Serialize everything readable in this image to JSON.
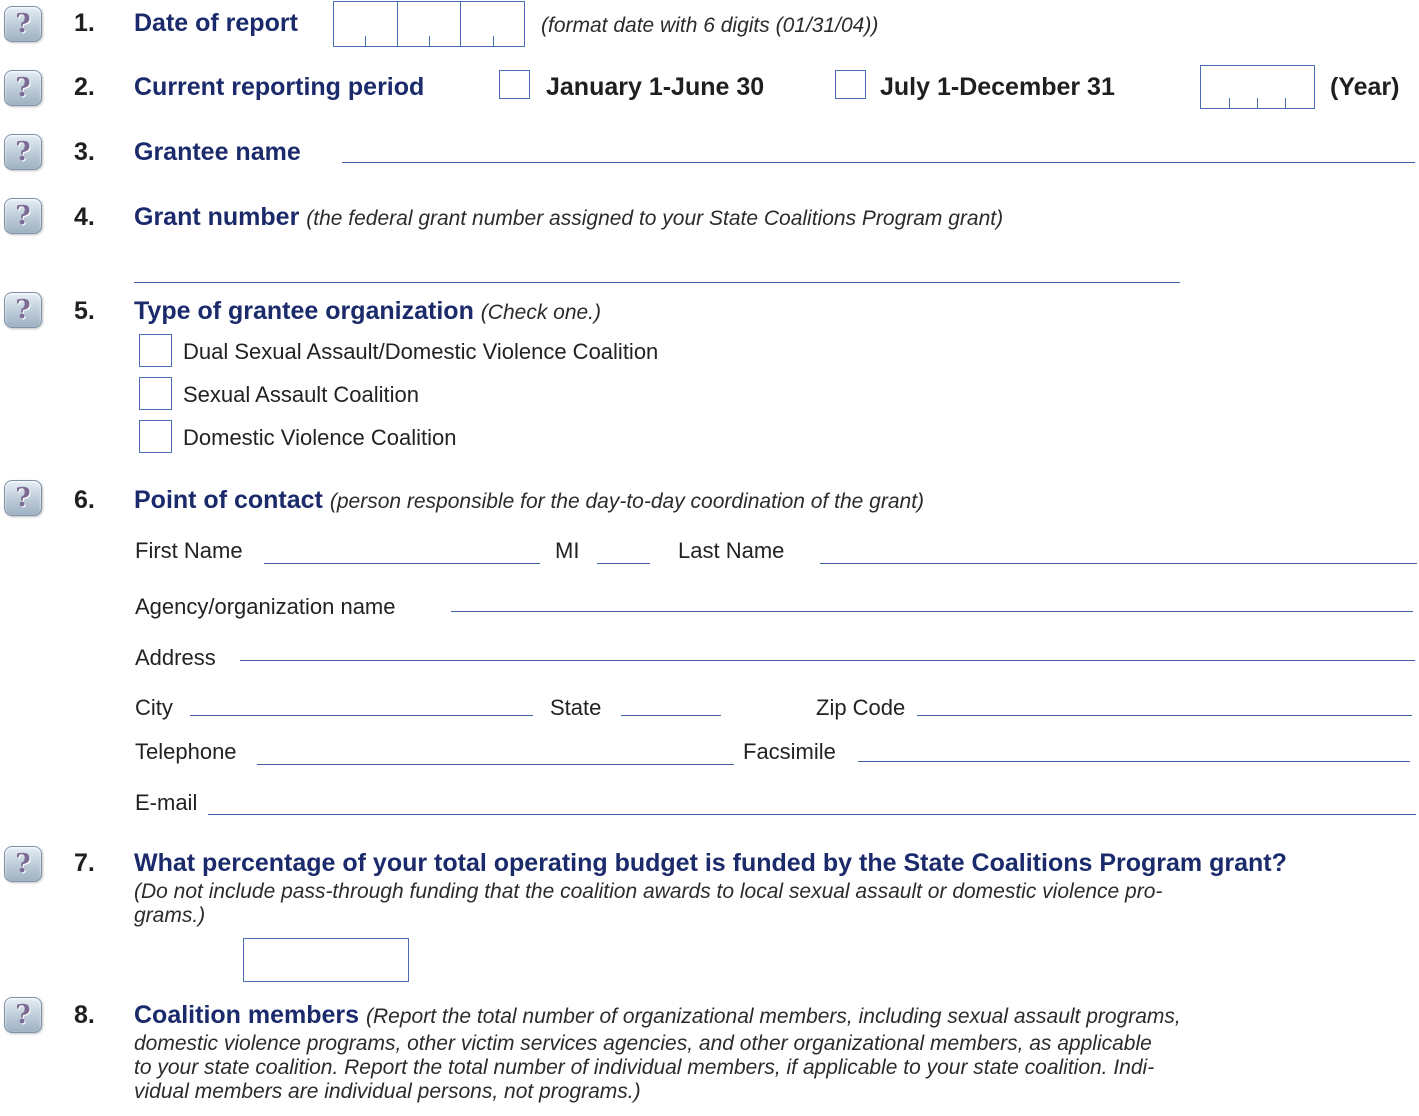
{
  "items": {
    "q1": {
      "num": "1.",
      "title": "Date of report",
      "hint": "(format date with 6 digits (01/31/04))"
    },
    "q2": {
      "num": "2.",
      "title": "Current reporting period",
      "opt1": "January 1-June 30",
      "opt2": "July 1-December 31",
      "year": "(Year)"
    },
    "q3": {
      "num": "3.",
      "title": "Grantee name"
    },
    "q4": {
      "num": "4.",
      "title": "Grant number",
      "hint": "(the federal grant number assigned to your State Coalitions Program grant)"
    },
    "q5": {
      "num": "5.",
      "title": "Type of grantee organization",
      "hint": "(Check one.)",
      "options": [
        "Dual Sexual Assault/Domestic Violence Coalition",
        "Sexual Assault Coalition",
        "Domestic Violence Coalition"
      ]
    },
    "q6": {
      "num": "6.",
      "title": "Point of contact",
      "hint": "(person responsible for the day-to-day coordination of the grant)",
      "fields": {
        "first_name": "First Name",
        "mi": "MI",
        "last_name": "Last Name",
        "agency": "Agency/organization name",
        "address": "Address",
        "city": "City",
        "state": "State",
        "zip": "Zip Code",
        "telephone": "Telephone",
        "fax": "Facsimile",
        "email": "E-mail"
      }
    },
    "q7": {
      "num": "7.",
      "title": "What percentage of your total operating budget is funded by the State Coalitions Program grant?",
      "hint_l1": "(Do not include pass-through funding that the coalition awards to local sexual assault or domestic violence pro-",
      "hint_l2": "grams.)"
    },
    "q8": {
      "num": "8.",
      "title": "Coalition members",
      "hint_l1": "(Report the total number of organizational members, including sexual assault programs,",
      "hint_l2": "domestic violence programs, other victim services agencies, and other organizational members, as applicable",
      "hint_l3": "to your state coalition.  Report the total number of individual members, if applicable to your state coalition.  Indi-",
      "hint_l4": "vidual members are individual persons, not programs.)"
    }
  },
  "help_icon": "question-mark-icon",
  "colors": {
    "heading_navy": "#1a2a6b",
    "field_blue": "#4b6cb7"
  }
}
